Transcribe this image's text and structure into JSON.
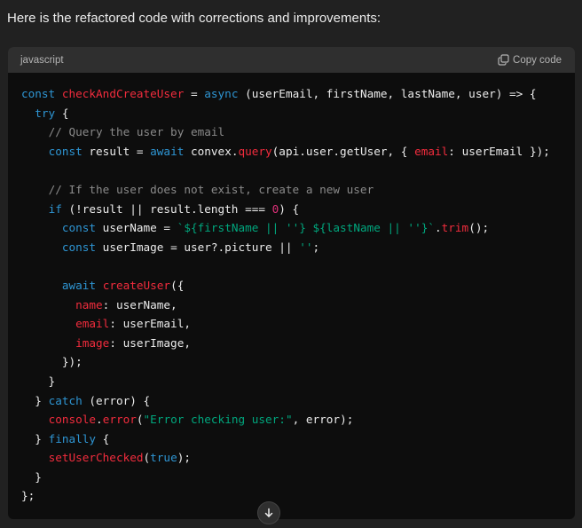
{
  "message": {
    "intro_text": "Here is the refactored code with corrections and improvements:"
  },
  "code_block": {
    "language": "javascript",
    "copy_label": "Copy code",
    "copy_icon": "clipboard-icon",
    "lines": [
      [
        [
          "const ",
          "kw"
        ],
        [
          "checkAndCreateUser",
          "fn"
        ],
        [
          " = ",
          ""
        ],
        [
          "async",
          "kw"
        ],
        [
          " (userEmail, firstName, lastName, user) => {",
          ""
        ]
      ],
      [
        [
          "  ",
          ""
        ],
        [
          "try",
          "kw"
        ],
        [
          " {",
          ""
        ]
      ],
      [
        [
          "    ",
          ""
        ],
        [
          "// Query the user by email",
          "cm"
        ]
      ],
      [
        [
          "    ",
          ""
        ],
        [
          "const",
          "kw"
        ],
        [
          " result = ",
          ""
        ],
        [
          "await",
          "kw"
        ],
        [
          " convex.",
          ""
        ],
        [
          "query",
          "fn"
        ],
        [
          "(api.user.getUser, { ",
          ""
        ],
        [
          "email",
          "pr"
        ],
        [
          ": userEmail });",
          ""
        ]
      ],
      [
        [
          "",
          ""
        ]
      ],
      [
        [
          "    ",
          ""
        ],
        [
          "// If the user does not exist, create a new user",
          "cm"
        ]
      ],
      [
        [
          "    ",
          ""
        ],
        [
          "if",
          "kw"
        ],
        [
          " (!result || result.length === ",
          ""
        ],
        [
          "0",
          "num"
        ],
        [
          ") {",
          ""
        ]
      ],
      [
        [
          "      ",
          ""
        ],
        [
          "const",
          "kw"
        ],
        [
          " userName = ",
          ""
        ],
        [
          "`${firstName || ''} ${lastName || ''}`",
          "str"
        ],
        [
          ".",
          ""
        ],
        [
          "trim",
          "fn"
        ],
        [
          "();",
          ""
        ]
      ],
      [
        [
          "      ",
          ""
        ],
        [
          "const",
          "kw"
        ],
        [
          " userImage = user?.picture || ",
          ""
        ],
        [
          "''",
          "str"
        ],
        [
          ";",
          ""
        ]
      ],
      [
        [
          "",
          ""
        ]
      ],
      [
        [
          "      ",
          ""
        ],
        [
          "await",
          "kw"
        ],
        [
          " ",
          ""
        ],
        [
          "createUser",
          "fn"
        ],
        [
          "({",
          ""
        ]
      ],
      [
        [
          "        ",
          ""
        ],
        [
          "name",
          "pr"
        ],
        [
          ": userName,",
          ""
        ]
      ],
      [
        [
          "        ",
          ""
        ],
        [
          "email",
          "pr"
        ],
        [
          ": userEmail,",
          ""
        ]
      ],
      [
        [
          "        ",
          ""
        ],
        [
          "image",
          "pr"
        ],
        [
          ": userImage,",
          ""
        ]
      ],
      [
        [
          "      });",
          ""
        ]
      ],
      [
        [
          "    }",
          ""
        ]
      ],
      [
        [
          "  } ",
          ""
        ],
        [
          "catch",
          "kw"
        ],
        [
          " (error) {",
          ""
        ]
      ],
      [
        [
          "    ",
          ""
        ],
        [
          "console",
          "fn"
        ],
        [
          ".",
          ""
        ],
        [
          "error",
          "fn"
        ],
        [
          "(",
          ""
        ],
        [
          "\"Error checking user:\"",
          "str"
        ],
        [
          ", error);",
          ""
        ]
      ],
      [
        [
          "  } ",
          ""
        ],
        [
          "finally",
          "kw"
        ],
        [
          " {",
          ""
        ]
      ],
      [
        [
          "    ",
          ""
        ],
        [
          "setUserChecked",
          "fn"
        ],
        [
          "(",
          ""
        ],
        [
          "true",
          "kw"
        ],
        [
          ");",
          ""
        ]
      ],
      [
        [
          "  }",
          ""
        ]
      ],
      [
        [
          "};",
          ""
        ]
      ]
    ]
  },
  "scroll_down": {
    "icon": "arrow-down-icon"
  }
}
